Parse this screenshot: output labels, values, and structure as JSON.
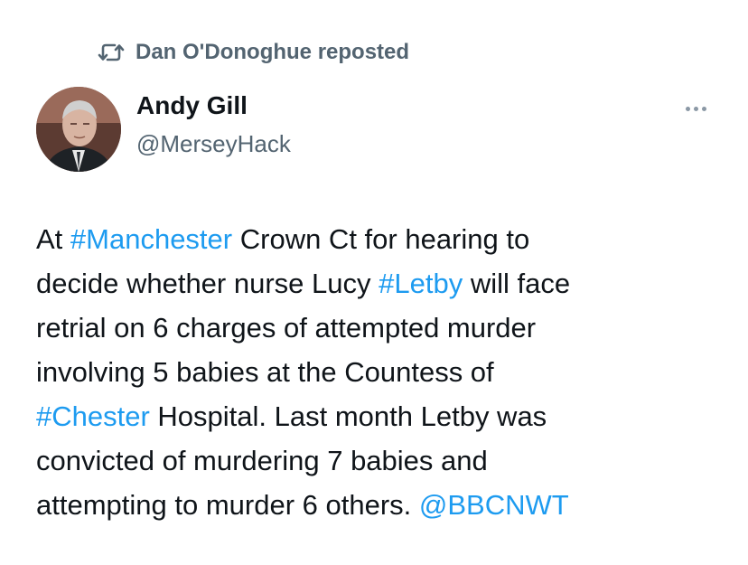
{
  "repost": {
    "icon": "repost-icon",
    "text": "Dan O'Donoghue reposted"
  },
  "author": {
    "avatar": "avatar",
    "name": "Andy Gill",
    "handle": "@MerseyHack"
  },
  "more_menu": {
    "icon": "more-icon"
  },
  "tweet": {
    "line1": {
      "pre": "At ",
      "hashtag1": "#Manchester",
      "post": " Crown Ct for hearing to"
    },
    "line2": {
      "pre": "decide whether nurse Lucy ",
      "hashtag2": "#Letby",
      "post": " will face"
    },
    "line3": "retrial on 6 charges of attempted murder",
    "line4": "involving 5 babies at the Countess of",
    "line5": {
      "hashtag3": "#Chester",
      "post": " Hospital. Last month Letby was"
    },
    "line6": "convicted of murdering 7 babies and",
    "line7": {
      "pre": "attempting to murder 6 others. ",
      "mention": "@BBCNWT"
    }
  },
  "colors": {
    "link": "#1d9bf0",
    "text": "#0f1419",
    "secondary": "#536471"
  }
}
